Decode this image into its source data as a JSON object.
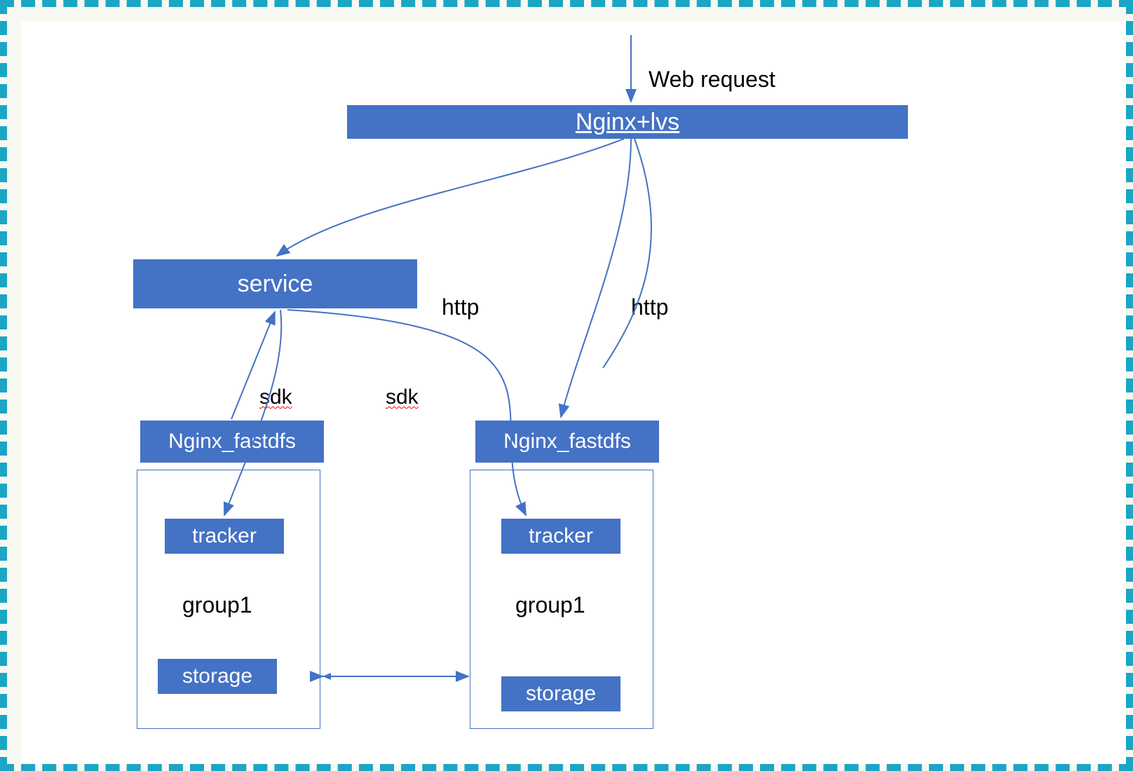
{
  "labels": {
    "web_request": "Web request",
    "http_left": "http",
    "http_right": "http",
    "sdk_left": "sdk",
    "sdk_right": "sdk",
    "group1_left": "group1",
    "group1_right": "group1"
  },
  "nodes": {
    "nginx_lvs": "Nginx+lvs",
    "service": "service",
    "nginx_fastdfs_left": "Nginx_fastdfs",
    "nginx_fastdfs_right": "Nginx_fastdfs",
    "tracker_left": "tracker",
    "tracker_right": "tracker",
    "storage_left": "storage",
    "storage_right": "storage"
  },
  "colors": {
    "box_fill": "#4472c4",
    "border_dash": "#1aa6c4",
    "arrow": "#4472c4",
    "text_on_box": "#ffffff",
    "text_label": "#000000"
  },
  "diagram": {
    "edges": [
      {
        "from": "web_request",
        "to": "nginx_lvs",
        "type": "arrow"
      },
      {
        "from": "nginx_lvs",
        "to": "service",
        "type": "curve",
        "label": null
      },
      {
        "from": "nginx_lvs",
        "to": "nginx_fastdfs_right",
        "type": "curve",
        "label": "http"
      },
      {
        "from": "nginx_lvs",
        "to": "tracker_right_area",
        "type": "curve",
        "label": "http"
      },
      {
        "from": "service",
        "to": "tracker_left",
        "type": "curve",
        "label": "sdk"
      },
      {
        "from": "service",
        "to": "tracker_right",
        "type": "curve",
        "label": "sdk"
      },
      {
        "from": "nginx_fastdfs_left",
        "to": "service",
        "type": "arrow"
      },
      {
        "from": "storage_left",
        "to": "storage_right",
        "type": "double_arrow"
      }
    ]
  }
}
